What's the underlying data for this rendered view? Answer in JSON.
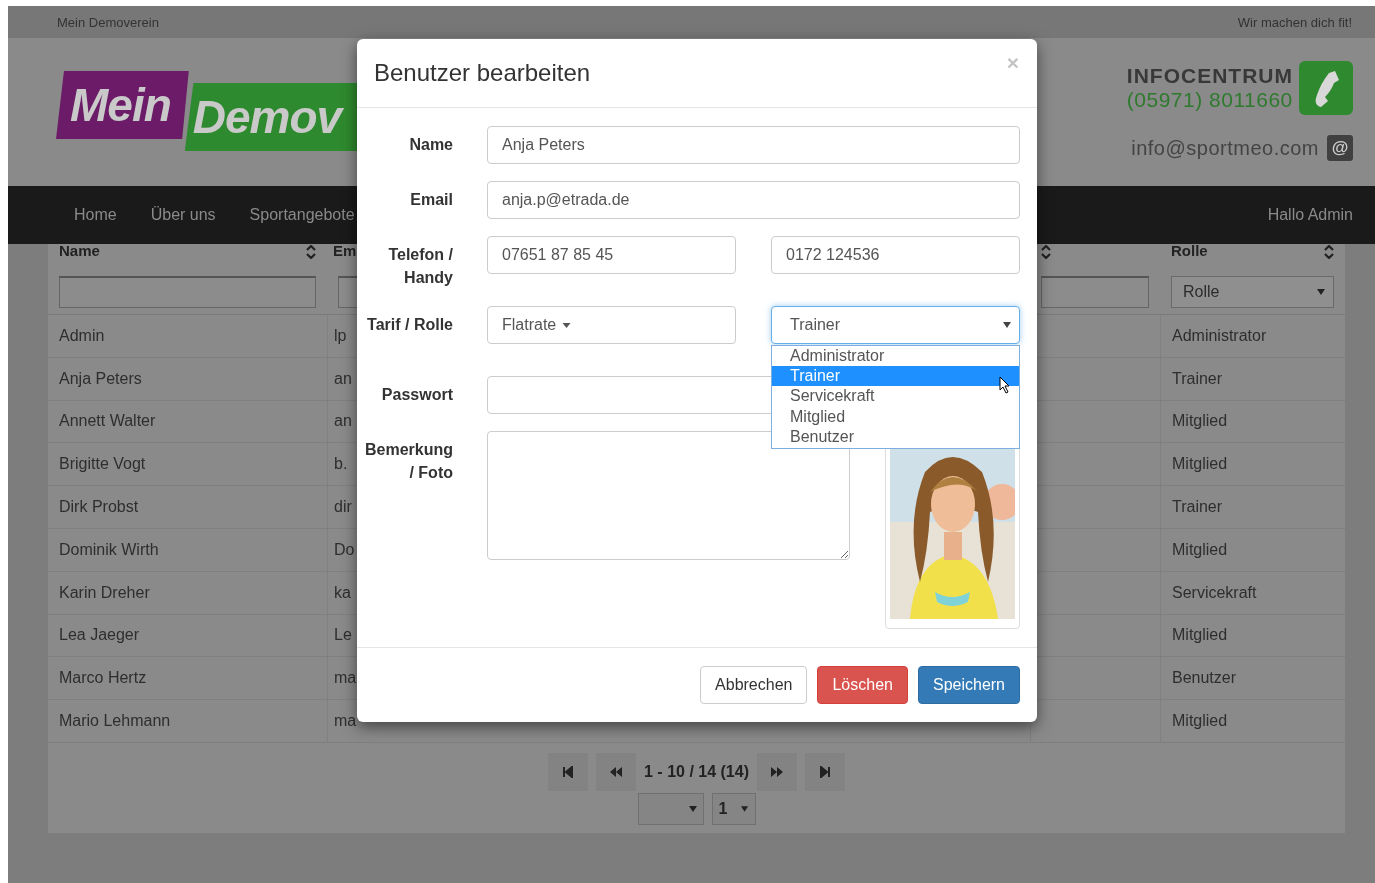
{
  "top_bar": {
    "site_name": "Mein Demoverein",
    "slogan": "Wir machen dich fit!"
  },
  "header": {
    "logo": [
      "Mein",
      "Demov"
    ],
    "info_title": "INFOCENTRUM",
    "phone": "(05971) 8011660",
    "email": "info@sportmeo.com",
    "email_icon": "@"
  },
  "nav": {
    "items": [
      "Home",
      "Über uns",
      "Sportangebote"
    ],
    "user": "Hallo Admin"
  },
  "table": {
    "columns": [
      {
        "label": "Name",
        "sortable": true
      },
      {
        "label": "Em",
        "sortable": false
      },
      {
        "sortable": true
      },
      {
        "label": "Rolle",
        "sortable": true
      }
    ],
    "filters": [
      {
        "kind": "input"
      },
      {
        "kind": "input"
      },
      {
        "kind": "input"
      },
      {
        "kind": "select",
        "value": "Rolle"
      }
    ],
    "rows": [
      {
        "name": "Admin",
        "email": "lp",
        "role": "Administrator"
      },
      {
        "name": "Anja Peters",
        "email": "an",
        "role": "Trainer"
      },
      {
        "name": "Annett Walter",
        "email": "an",
        "role": "Mitglied"
      },
      {
        "name": "Brigitte Vogt",
        "email": "b.",
        "role": "Mitglied"
      },
      {
        "name": "Dirk Probst",
        "email": "dir",
        "role": "Trainer"
      },
      {
        "name": "Dominik Wirth",
        "email": "Do",
        "role": "Mitglied"
      },
      {
        "name": "Karin Dreher",
        "email": "ka",
        "role": "Servicekraft"
      },
      {
        "name": "Lea Jaeger",
        "email": "Le",
        "role": "Mitglied"
      },
      {
        "name": "Marco Hertz",
        "email": "ma",
        "role": "Benutzer"
      },
      {
        "name": "Mario Lehmann",
        "email": "ma",
        "role": "Mitglied"
      }
    ]
  },
  "pager": {
    "range": "1 - 10 / 14 (14)",
    "page": "1"
  },
  "modal": {
    "title": "Benutzer bearbeiten",
    "close": "×",
    "labels": {
      "name": "Name",
      "email": "Email",
      "phone": "Telefon / Handy",
      "tariff_role": "Tarif / Rolle",
      "password": "Passwort",
      "remark": "Bemerkung / Foto"
    },
    "name": "Anja Peters",
    "email": "anja.p@etrada.de",
    "phone": "07651 87 85 45",
    "mobile": "0172 124536",
    "tariff": "Flatrate",
    "role_select": {
      "value": "Trainer",
      "expanded": true,
      "options": [
        {
          "label": "Administrator",
          "selected": false
        },
        {
          "label": "Trainer",
          "selected": true
        },
        {
          "label": "Servicekraft",
          "selected": false
        },
        {
          "label": "Mitglied",
          "selected": false
        },
        {
          "label": "Benutzer",
          "selected": false
        }
      ]
    },
    "buttons": [
      {
        "label": "Abbrechen",
        "kind": "default"
      },
      {
        "label": "Löschen",
        "kind": "danger"
      },
      {
        "label": "Speichern",
        "kind": "primary"
      }
    ]
  }
}
